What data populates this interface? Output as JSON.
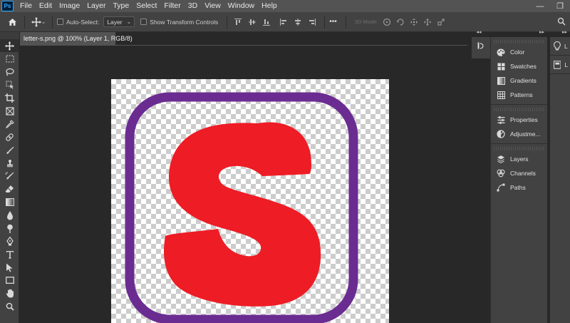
{
  "app": {
    "logo_text": "Ps",
    "menu": [
      "File",
      "Edit",
      "Image",
      "Layer",
      "Type",
      "Select",
      "Filter",
      "3D",
      "View",
      "Window",
      "Help"
    ],
    "window_controls": {
      "minimize": "—",
      "restore": "❐",
      "close": "✕"
    }
  },
  "options": {
    "auto_select_label": "Auto-Select:",
    "auto_select_target": "Layer",
    "show_transform_label": "Show Transform Controls",
    "more_label": "•••",
    "mode_3d_label": "3D Mode:"
  },
  "document": {
    "tab_title": "letter-s.png @ 100% (Layer 1, RGB/8)",
    "artwork": {
      "letter": "S",
      "letter_color": "#ee1c25",
      "frame_color": "#6b2c91"
    }
  },
  "tools": [
    "move-tool",
    "marquee-tool",
    "lasso-tool",
    "object-select-tool",
    "crop-tool",
    "frame-tool",
    "eyedropper-tool",
    "healing-brush-tool",
    "brush-tool",
    "clone-stamp-tool",
    "history-brush-tool",
    "eraser-tool",
    "gradient-tool",
    "blur-tool",
    "dodge-tool",
    "pen-tool",
    "type-tool",
    "path-select-tool",
    "rectangle-tool",
    "hand-tool",
    "zoom-tool"
  ],
  "panels": {
    "group1": [
      {
        "label": "Color",
        "icon": "color-icon"
      },
      {
        "label": "Swatches",
        "icon": "swatches-icon"
      },
      {
        "label": "Gradients",
        "icon": "gradients-icon"
      },
      {
        "label": "Patterns",
        "icon": "patterns-icon"
      }
    ],
    "group2": [
      {
        "label": "Properties",
        "icon": "properties-icon"
      },
      {
        "label": "Adjustme...",
        "icon": "adjustments-icon"
      }
    ],
    "group3": [
      {
        "label": "Layers",
        "icon": "layers-icon"
      },
      {
        "label": "Channels",
        "icon": "channels-icon"
      },
      {
        "label": "Paths",
        "icon": "paths-icon"
      }
    ],
    "far": [
      {
        "label": "L",
        "icon": "learn-icon"
      },
      {
        "label": "L",
        "icon": "libraries-icon"
      }
    ]
  }
}
